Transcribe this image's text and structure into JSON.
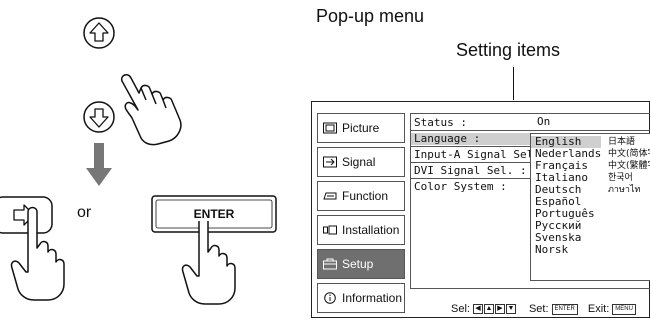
{
  "annotations": {
    "popup_menu": "Pop-up menu",
    "setting_items": "Setting items"
  },
  "illustration": {
    "or": "or",
    "enter_key": "ENTER"
  },
  "sidebar": {
    "items": [
      {
        "label": "Picture",
        "icon": "picture-icon",
        "selected": false
      },
      {
        "label": "Signal",
        "icon": "signal-icon",
        "selected": false
      },
      {
        "label": "Function",
        "icon": "function-icon",
        "selected": false
      },
      {
        "label": "Installation",
        "icon": "installation-icon",
        "selected": false
      },
      {
        "label": "Setup",
        "icon": "setup-icon",
        "selected": true
      },
      {
        "label": "Information",
        "icon": "information-icon",
        "selected": false
      }
    ]
  },
  "settings": {
    "rows": [
      {
        "label": "Status :",
        "value": "On"
      },
      {
        "label": "Language :",
        "highlighted": true
      },
      {
        "label": "Input-A Signal Sel."
      },
      {
        "label": "DVI Signal Sel. :"
      },
      {
        "label": "Color System :"
      }
    ]
  },
  "language_popup": {
    "selected": "English",
    "column1": [
      "English",
      "Nederlands",
      "Français",
      "Italiano",
      "Deutsch",
      "Español",
      "Português",
      "Русский",
      "Svenska",
      "Norsk"
    ],
    "column2": [
      "日本語",
      "中文(简体字",
      "中文(繁體字",
      "한국어",
      "ภาษาไท"
    ]
  },
  "footer": {
    "sel_label": "Sel:",
    "set_label": "Set:",
    "set_key": "ENTER",
    "exit_label": "Exit:",
    "exit_key": "MENU"
  },
  "colors": {
    "selected_bg": "#6f6f6f",
    "highlight_bg": "#cfcfcf"
  }
}
